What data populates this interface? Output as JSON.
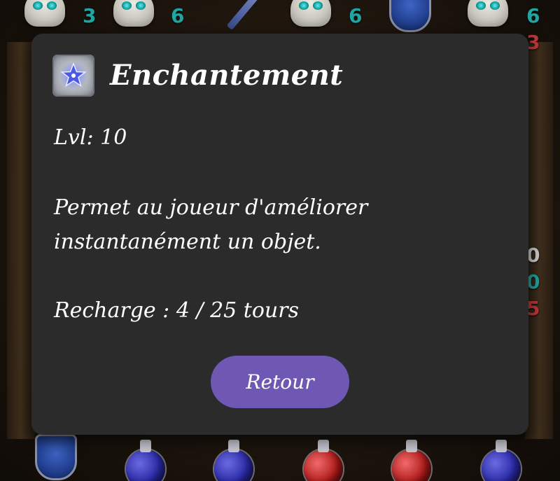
{
  "board": {
    "top_row_numbers": [
      {
        "value": "3",
        "color": "#1fa6a0"
      },
      {
        "value": "6",
        "color": "#1fa6a0"
      },
      {
        "value": "6",
        "color": "#1fa6a0"
      },
      {
        "value": "6",
        "color": "#1fa6a0"
      }
    ],
    "right_column_numbers": [
      {
        "value": "3",
        "color": "#c0393a"
      },
      {
        "value": "0",
        "color": "#cfcfcf"
      },
      {
        "value": "0",
        "color": "#1fa6a0"
      },
      {
        "value": "5",
        "color": "#c0393a"
      }
    ],
    "top_row_tiles": [
      "skull-icon",
      "skull-icon",
      "sword-icon",
      "skull-icon",
      "shield-icon",
      "skull-icon"
    ],
    "bottom_row_tiles": [
      "shield-icon",
      "blue-potion-icon",
      "blue-potion-icon",
      "red-potion-icon",
      "red-potion-icon",
      "blue-potion-icon"
    ]
  },
  "dialog": {
    "icon": "enchant-star-icon",
    "title": "Enchantement",
    "level": "Lvl: 10",
    "description_line_1": "Permet au joueur d'améliorer",
    "description_line_2": "instantanément un objet.",
    "recharge": "Recharge : 4 / 25 tours",
    "back_button_label": "Retour",
    "colors": {
      "panel": "#2b2b2b",
      "button": "#6f57b4",
      "text": "#ffffff"
    }
  }
}
